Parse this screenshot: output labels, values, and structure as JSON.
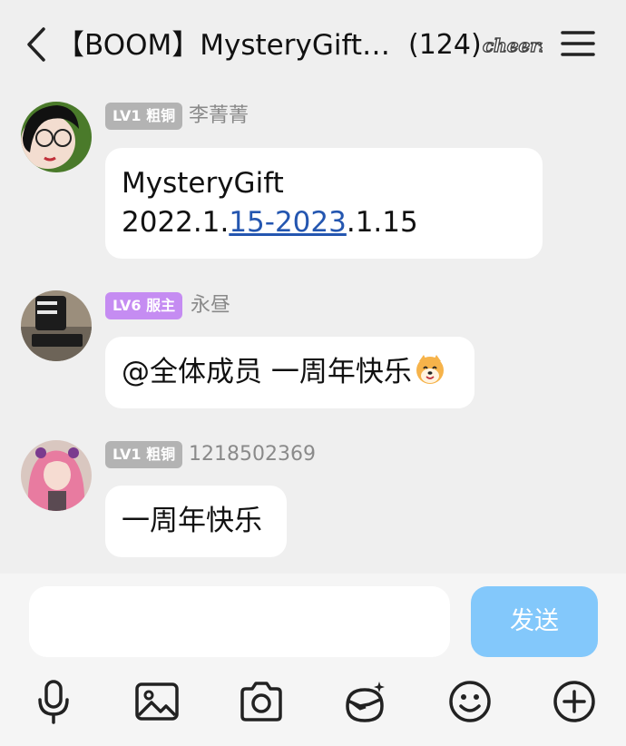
{
  "header": {
    "title": "【BOOM】MysteryGift…",
    "member_count": "(124)",
    "cheers_text": "cheers"
  },
  "messages": [
    {
      "level": "LV1 粗铜",
      "level_color": "#b3b3b3",
      "name": "李菁菁",
      "line1": "MysteryGift",
      "line2_pre": "2022.1.",
      "line2_link": "15-2023",
      "line2_post": ".1.15"
    },
    {
      "level": "LV6 服主",
      "level_color": "#c58cf2",
      "name": "永昼",
      "text": "@全体成员 一周年快乐",
      "emoji": "dog-emoji"
    },
    {
      "level": "LV1 粗铜",
      "level_color": "#b3b3b3",
      "name": "1218502369",
      "text": "一周年快乐"
    }
  ],
  "composer": {
    "placeholder": "",
    "send_label": "发送",
    "send_color": "#83c8fb"
  },
  "toolbar": [
    "microphone-icon",
    "image-icon",
    "camera-icon",
    "ar-glasses-icon",
    "smiley-icon",
    "plus-icon"
  ]
}
